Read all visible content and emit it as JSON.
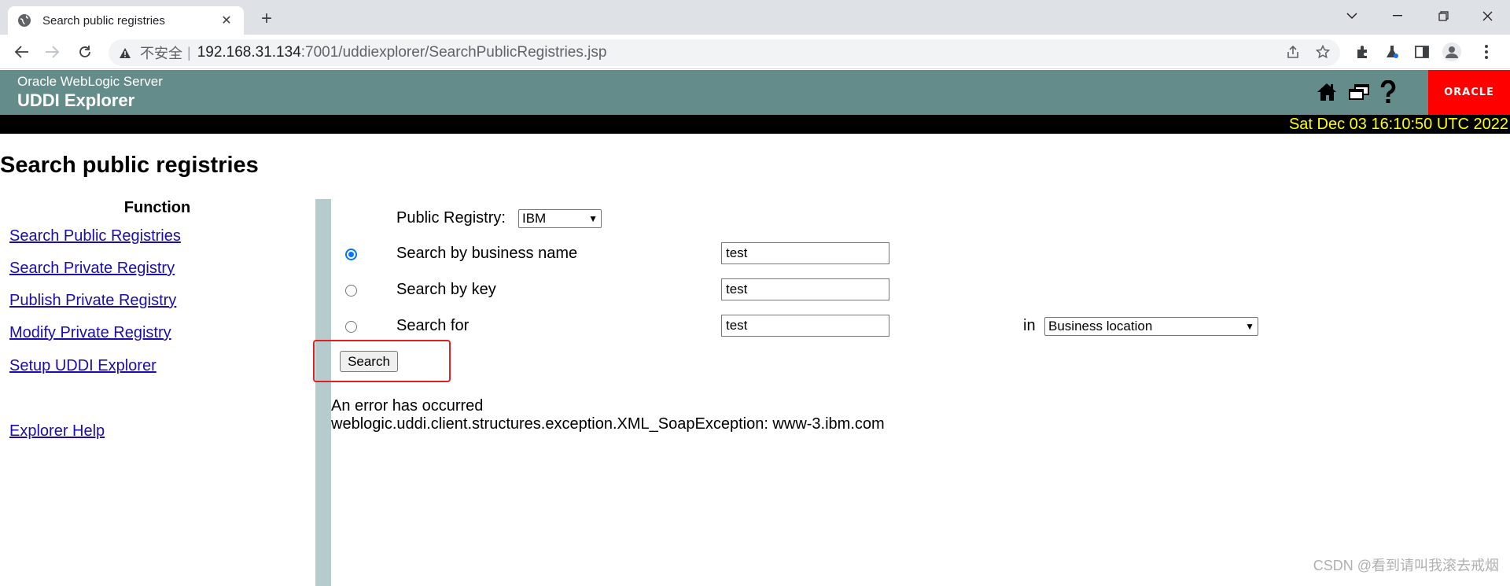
{
  "browser": {
    "tab_title": "Search public registries",
    "security_label": "不安全",
    "separator": "|",
    "url_host": "192.168.31.134",
    "url_path": ":7001/uddiexplorer/SearchPublicRegistries.jsp"
  },
  "header": {
    "product": "Oracle WebLogic Server",
    "app_name": "UDDI Explorer",
    "logo_text": "ORACLE",
    "datetime": "Sat Dec 03 16:10:50 UTC 2022"
  },
  "page": {
    "title": "Search public registries"
  },
  "sidebar": {
    "heading": "Function",
    "links": [
      "Search Public Registries",
      "Search Private Registry",
      "Publish Private Registry",
      "Modify Private Registry",
      "Setup UDDI Explorer",
      "Explorer Help"
    ]
  },
  "form": {
    "registry_label": "Public Registry:",
    "registry_value": "IBM",
    "options": [
      {
        "label": "Search by business name",
        "value": "test",
        "selected": true
      },
      {
        "label": "Search by key",
        "value": "test",
        "selected": false
      },
      {
        "label": "Search for",
        "value": "test",
        "selected": false
      }
    ],
    "in_label": "in",
    "in_value": "Business location",
    "search_button": "Search"
  },
  "error": {
    "line1": "An error has occurred",
    "line2": "weblogic.uddi.client.structures.exception.XML_SoapException: www-3.ibm.com"
  },
  "watermark": "CSDN @看到请叫我滚去戒烟",
  "colors": {
    "header_bg": "#648c8b",
    "date_text": "#ffff00",
    "logo_bg": "#ff0000",
    "divider": "#b6cccc",
    "highlight": "#e02020",
    "link": "#1a0dab"
  }
}
